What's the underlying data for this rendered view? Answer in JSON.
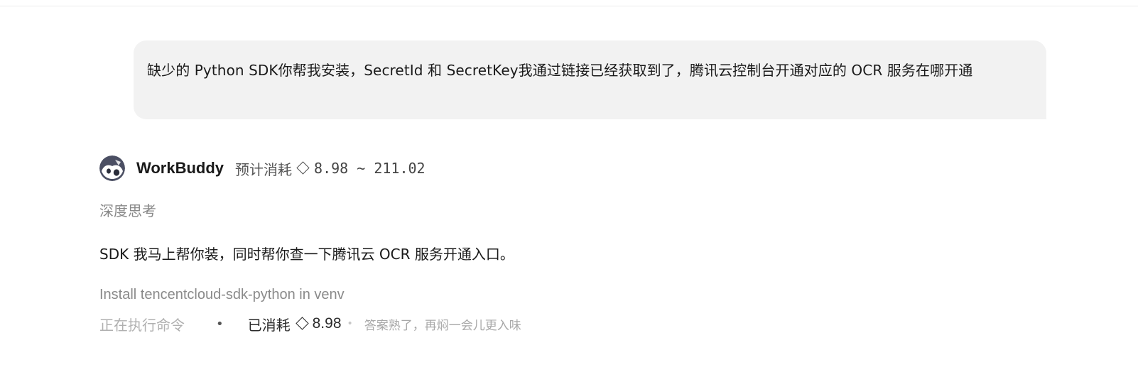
{
  "user_message": {
    "text": "缺少的 Python SDK你帮我安装，SecretId 和 SecretKey我通过链接已经获取到了，腾讯云控制台开通对应的 OCR 服务在哪开通"
  },
  "assistant": {
    "name": "WorkBuddy",
    "estimate_label": "预计消耗",
    "estimate_range": "8.98 ~ 211.02",
    "thinking_label": "深度思考",
    "reply": "SDK 我马上帮你装，同时帮你查一下腾讯云 OCR 服务开通入口。",
    "tool_step": "Install tencentcloud-sdk-python in venv"
  },
  "status": {
    "running_label": "正在执行命令",
    "separator": "•",
    "consumed_label": "已消耗",
    "consumed_value": "8.98",
    "separator_light": "•",
    "hint": "答案熟了，再焖一会儿更入味"
  },
  "icons": {
    "avatar": "robot-avatar-icon",
    "credit": "diamond-icon"
  },
  "colors": {
    "bubble_bg": "#f2f2f2",
    "muted_text": "#888888",
    "faint_text": "#b0b0b0"
  }
}
